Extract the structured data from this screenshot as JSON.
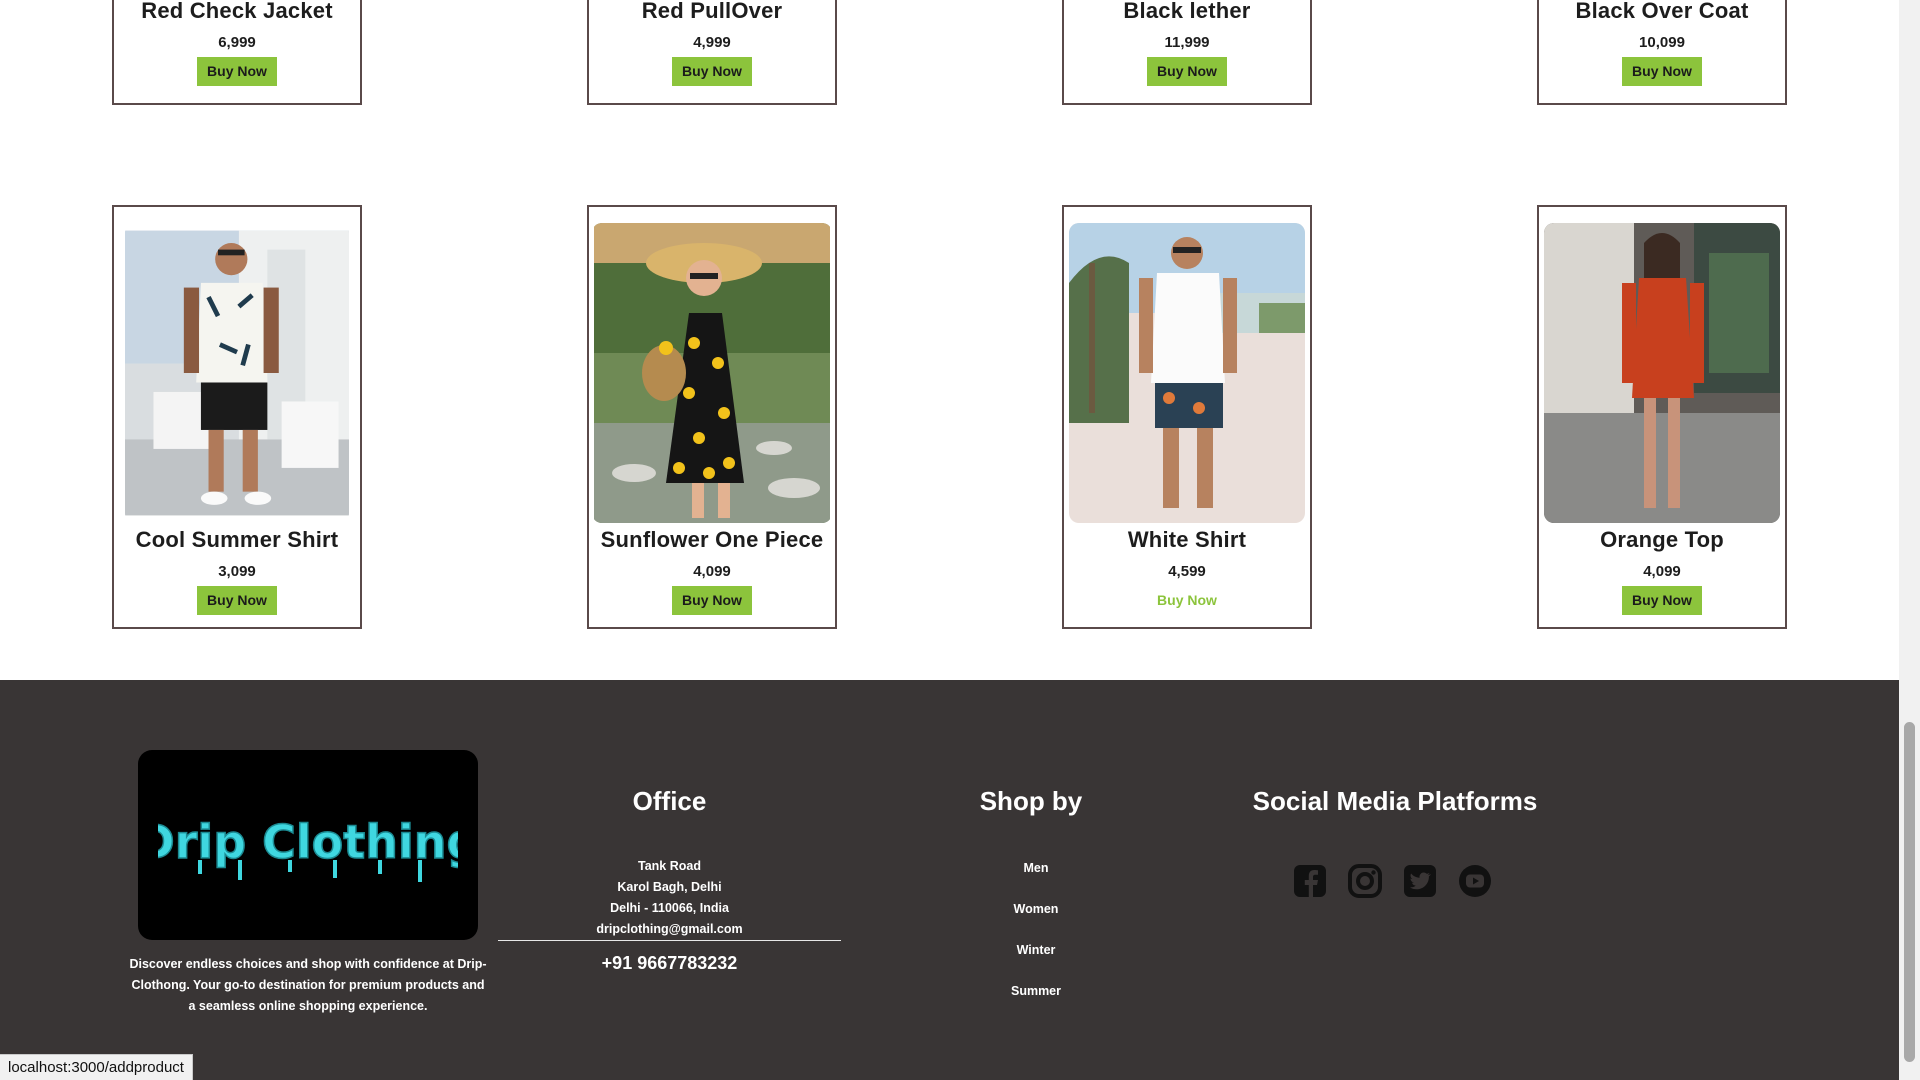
{
  "top_row": [
    {
      "name": "Red Check Jacket",
      "price": "6,999",
      "button": "Buy Now"
    },
    {
      "name": "Red PullOver",
      "price": "4,999",
      "button": "Buy Now"
    },
    {
      "name": "Black lether",
      "price": "11,999",
      "button": "Buy Now"
    },
    {
      "name": "Black Over Coat",
      "price": "10,099",
      "button": "Buy Now"
    }
  ],
  "bottom_row": [
    {
      "name": "Cool Summer Shirt",
      "price": "3,099",
      "button": "Buy Now"
    },
    {
      "name": "Sunflower One Piece",
      "price": "4,099",
      "button": "Buy Now"
    },
    {
      "name": "White Shirt",
      "price": "4,599",
      "button": "Buy Now"
    },
    {
      "name": "Orange Top",
      "price": "4,099",
      "button": "Buy Now"
    }
  ],
  "footer": {
    "logo_text": "Drip Clothing",
    "about": "Discover endless choices and shop with confidence at Drip-Clothong. Your go-to destination for premium products and a seamless online shopping experience.",
    "office": {
      "title": "Office",
      "lines": [
        "Tank Road",
        "Karol Bagh, Delhi",
        "Delhi - 110066, India",
        "dripclothing@gmail.com"
      ],
      "phone": "+91 9667783232"
    },
    "shop_by": {
      "title": "Shop by",
      "links": [
        "Men",
        "Women",
        "Winter",
        "Summer"
      ]
    },
    "social": {
      "title": "Social Media Platforms",
      "icons": [
        "facebook-icon",
        "instagram-icon",
        "twitter-icon",
        "youtube-icon"
      ]
    }
  },
  "status_url": "localhost:3000/addproduct",
  "colors": {
    "buy_button": "#8cc43c",
    "footer_bg": "#393535",
    "logo_text": "#3fd7e0"
  }
}
